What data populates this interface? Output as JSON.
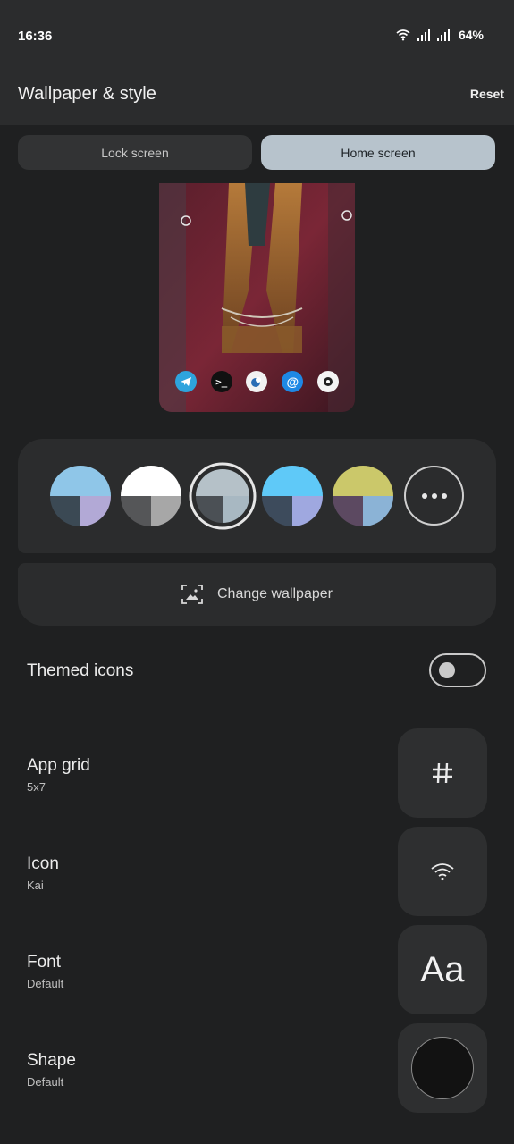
{
  "status": {
    "time": "16:36",
    "battery": "64%",
    "icons": [
      "wifi-icon",
      "signal-icon",
      "signal-icon"
    ]
  },
  "header": {
    "title": "Wallpaper & style",
    "reset_label": "Reset"
  },
  "tabs": [
    {
      "label": "Lock screen",
      "selected": false
    },
    {
      "label": "Home screen",
      "selected": true
    }
  ],
  "preview": {
    "dock_apps": [
      "telegram-icon",
      "terminal-icon",
      "chat-icon",
      "email-icon",
      "app-icon"
    ]
  },
  "palette": {
    "swatches": [
      {
        "top": "#8fc6e8",
        "bottom_left": "#3b4954",
        "bottom_right": "#b2a9d6",
        "selected": false
      },
      {
        "top": "#ffffff",
        "bottom_left": "#555658",
        "bottom_right": "#a7a7a7",
        "selected": false
      },
      {
        "top": "#b5c1c8",
        "bottom_left": "#4b5055",
        "bottom_right": "#a8b8c2",
        "selected": true
      },
      {
        "top": "#5fc9f8",
        "bottom_left": "#3d4b5c",
        "bottom_right": "#9fa8e0",
        "selected": false
      },
      {
        "top": "#cbc86a",
        "bottom_left": "#5c4961",
        "bottom_right": "#8bb3d6",
        "selected": false
      }
    ],
    "more_icon": "more-horizontal-icon"
  },
  "change_wallpaper": {
    "label": "Change wallpaper",
    "icon": "image-frame-icon"
  },
  "themed_icons": {
    "label": "Themed icons",
    "enabled": false
  },
  "settings": [
    {
      "title": "App grid",
      "value": "5x7",
      "icon": "grid-hash-icon"
    },
    {
      "title": "Icon",
      "value": "Kai",
      "icon": "wifi-icon"
    },
    {
      "title": "Font",
      "value": "Default",
      "glyph": "Aa"
    },
    {
      "title": "Shape",
      "value": "Default",
      "icon": "circle-shape-icon"
    }
  ],
  "colors": {
    "background": "#1f2021",
    "card": "#2b2c2d",
    "tab_selected": "#b7c3cc"
  }
}
